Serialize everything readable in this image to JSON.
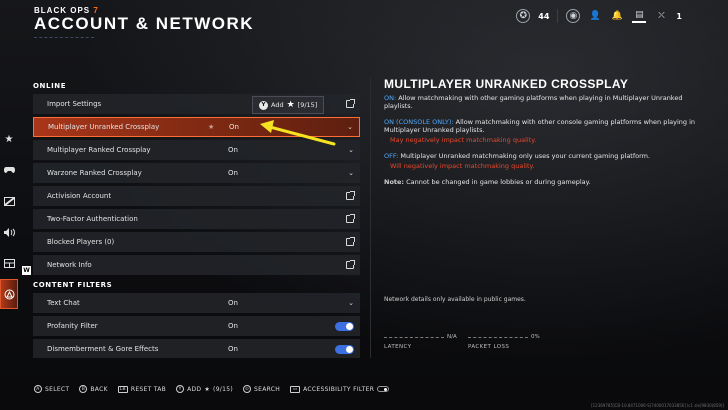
{
  "header": {
    "brand_text": "BLACK OPS",
    "brand_num": "7",
    "title": "ACCOUNT & NETWORK"
  },
  "topbar": {
    "level": "44",
    "party_count": "1"
  },
  "rail": {
    "items": [
      {
        "icon": "star-icon",
        "glyph": "★"
      },
      {
        "icon": "controller-icon",
        "glyph": "🎮"
      },
      {
        "icon": "display-icon",
        "glyph": "▨"
      },
      {
        "icon": "audio-icon",
        "glyph": "🔊"
      },
      {
        "icon": "interface-icon",
        "glyph": "⊞"
      },
      {
        "icon": "account-network-icon",
        "glyph": "⊗"
      }
    ],
    "flag": "W"
  },
  "sections": {
    "online": "ONLINE",
    "content_filters": "CONTENT FILTERS"
  },
  "rows": {
    "import_settings": {
      "label": "Import Settings"
    },
    "mp_unranked": {
      "label": "Multiplayer Unranked Crossplay",
      "value": "On"
    },
    "mp_ranked": {
      "label": "Multiplayer Ranked Crossplay",
      "value": "On"
    },
    "wz_ranked": {
      "label": "Warzone Ranked Crossplay",
      "value": "On"
    },
    "activision": {
      "label": "Activision Account"
    },
    "twofa": {
      "label": "Two-Factor Authentication"
    },
    "blocked": {
      "label": "Blocked Players (0)"
    },
    "network_info": {
      "label": "Network Info"
    },
    "text_chat": {
      "label": "Text Chat",
      "value": "On"
    },
    "profanity": {
      "label": "Profanity Filter",
      "value": "On"
    },
    "gore": {
      "label": "Dismemberment & Gore Effects",
      "value": "On"
    }
  },
  "tooltip": {
    "button": "Y",
    "text": "Add",
    "count": "[9/15]"
  },
  "info": {
    "title": "MULTIPLAYER UNRANKED CROSSPLAY",
    "on_key": "ON:",
    "on_text": " Allow matchmaking with other gaming platforms when playing in Multiplayer Unranked playlists.",
    "console_key": "ON (CONSOLE ONLY):",
    "console_text": " Allow matchmaking with other console gaming platforms when playing in Multiplayer Unranked playlists.",
    "console_warn": "May negatively impact matchmaking quality.",
    "off_key": "OFF:",
    "off_text": " Multiplayer Unranked matchmaking only uses your current gaming platform.",
    "off_warn": "Will negatively impact matchmaking quality.",
    "note_key": "Note:",
    "note_text": " Cannot be changed in game lobbies or during gameplay.",
    "network_note": "Network details only available in public games.",
    "latency_value": "N/A",
    "latency_label": "LATENCY",
    "packet_value": "0%",
    "packet_label": "PACKET LOSS"
  },
  "bottom": {
    "select": "SELECT",
    "back": "BACK",
    "reset_key": "LB",
    "reset": "RESET TAB",
    "add": "ADD",
    "add_count": "(9/15)",
    "search": "SEARCH",
    "accessibility": "ACCESSIBILITY FILTER"
  },
  "build": "[12369785]CB-10.8471006-S[7400017033856] lc1 sle[9830(859)]",
  "colors": {
    "accent": "#ff6e35",
    "link_blue": "#4fa9ff",
    "warn_red": "#e8482c",
    "toggle_blue": "#3c6fe0"
  }
}
